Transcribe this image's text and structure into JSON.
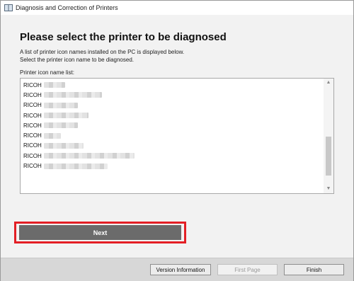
{
  "window": {
    "title": "Diagnosis and Correction of Printers"
  },
  "main": {
    "heading": "Please select the printer to be diagnosed",
    "description_line1": "A list of printer icon names installed on the PC is displayed below.",
    "description_line2": "Select the printer icon name to be diagnosed.",
    "list_label": "Printer icon name list:"
  },
  "printer_list": [
    {
      "prefix": "RICOH",
      "redacted": "blurred-name"
    },
    {
      "prefix": "RICOH",
      "redacted": "blurred-name"
    },
    {
      "prefix": "RICOH",
      "redacted": "blurred-name"
    },
    {
      "prefix": "RICOH",
      "redacted": "blurred-name"
    },
    {
      "prefix": "RICOH",
      "redacted": "blurred-name"
    },
    {
      "prefix": "RICOH",
      "redacted": "blurred-name"
    },
    {
      "prefix": "RICOH",
      "redacted": "blurred-name"
    },
    {
      "prefix": "RICOH",
      "redacted": "blurred-name"
    },
    {
      "prefix": "RICOH",
      "redacted": "blurred-name"
    }
  ],
  "buttons": {
    "next": "Next",
    "version_information": "Version Information",
    "first_page": "First Page",
    "finish": "Finish"
  },
  "colors": {
    "highlight": "#e31f25",
    "next_button_bg": "#6b6b6b",
    "footer_bg": "#d7d7d7"
  }
}
